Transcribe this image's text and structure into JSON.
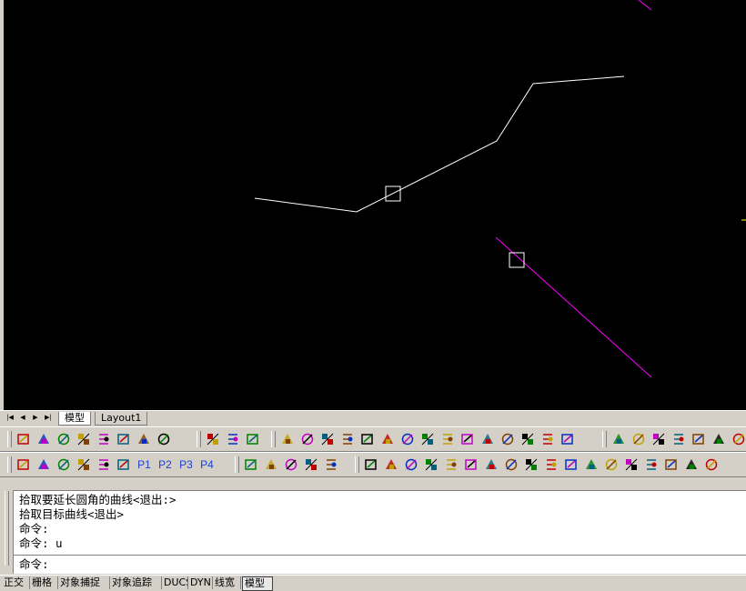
{
  "layout_tabs": [
    "模型",
    "Layout1"
  ],
  "toolbar1_icons": [
    "text-style-icon",
    "text-edit-icon",
    "dimension-text-icon",
    "check-text-icon",
    "text-replace-icon",
    "text-align-icon",
    "multiline-text-icon",
    "text-tool-icon",
    "lock-icon",
    "parallel-lines-icon",
    "hatch-icon",
    "gear-tool-icon",
    "rectangle-tool-icon",
    "dimension-h-icon",
    "dimension-v-icon",
    "dimension-elev-icon",
    "box-yellow-icon",
    "z-coord-icon",
    "pencil-icon",
    "rotate-text-icon",
    "underline-icon",
    "highlight-icon",
    "gear-tool-2-icon",
    "array-icon",
    "move-icon",
    "calculator-icon",
    "wizard-1-icon",
    "wizard-2-icon",
    "wizard-3-icon",
    "wizard-4-icon",
    "layout-1-icon",
    "layout-2-icon",
    "layout-3-icon"
  ],
  "toolbar2_icons": [
    "lock-icon",
    "open-folder-icon",
    "camera-icon",
    "flag-icon",
    "grid-p-icon",
    "p-box-icon"
  ],
  "toolbar2_p_labels": [
    "P1",
    "P2",
    "P3",
    "P4"
  ],
  "toolbar2_icons_b": [
    "xdata-icon",
    "dimension-icon",
    "tools-icon",
    "globe-link-icon",
    "file-save-icon",
    "edit-1-icon",
    "edit-2-icon",
    "edit-3-icon",
    "edit-4-icon",
    "edit-5-icon",
    "edit-6-icon",
    "edit-7-icon",
    "edit-8-icon",
    "edit-9-icon",
    "edit-10-icon",
    "edit-11-icon",
    "edit-12-icon",
    "edit-13-icon",
    "edit-14-icon",
    "edit-15-icon",
    "edit-16-icon",
    "edit-17-icon",
    "edit-18-icon"
  ],
  "command": {
    "history": [
      "拾取要延长圆角的曲线<退出:>",
      "拾取目标曲线<退出>",
      "命令:",
      "命令: u"
    ],
    "prompt": "命令:",
    "input_value": ""
  },
  "status_bar": [
    "正交",
    "栅格",
    "对象捕捉",
    "对象追踪",
    "DUCS",
    "DYN",
    "线宽",
    "模型"
  ],
  "colors": {
    "canvas_bg": "#000000",
    "white_line": "#ffffff",
    "magenta_line": "#ff00ff",
    "chrome": "#d4d0c8"
  }
}
